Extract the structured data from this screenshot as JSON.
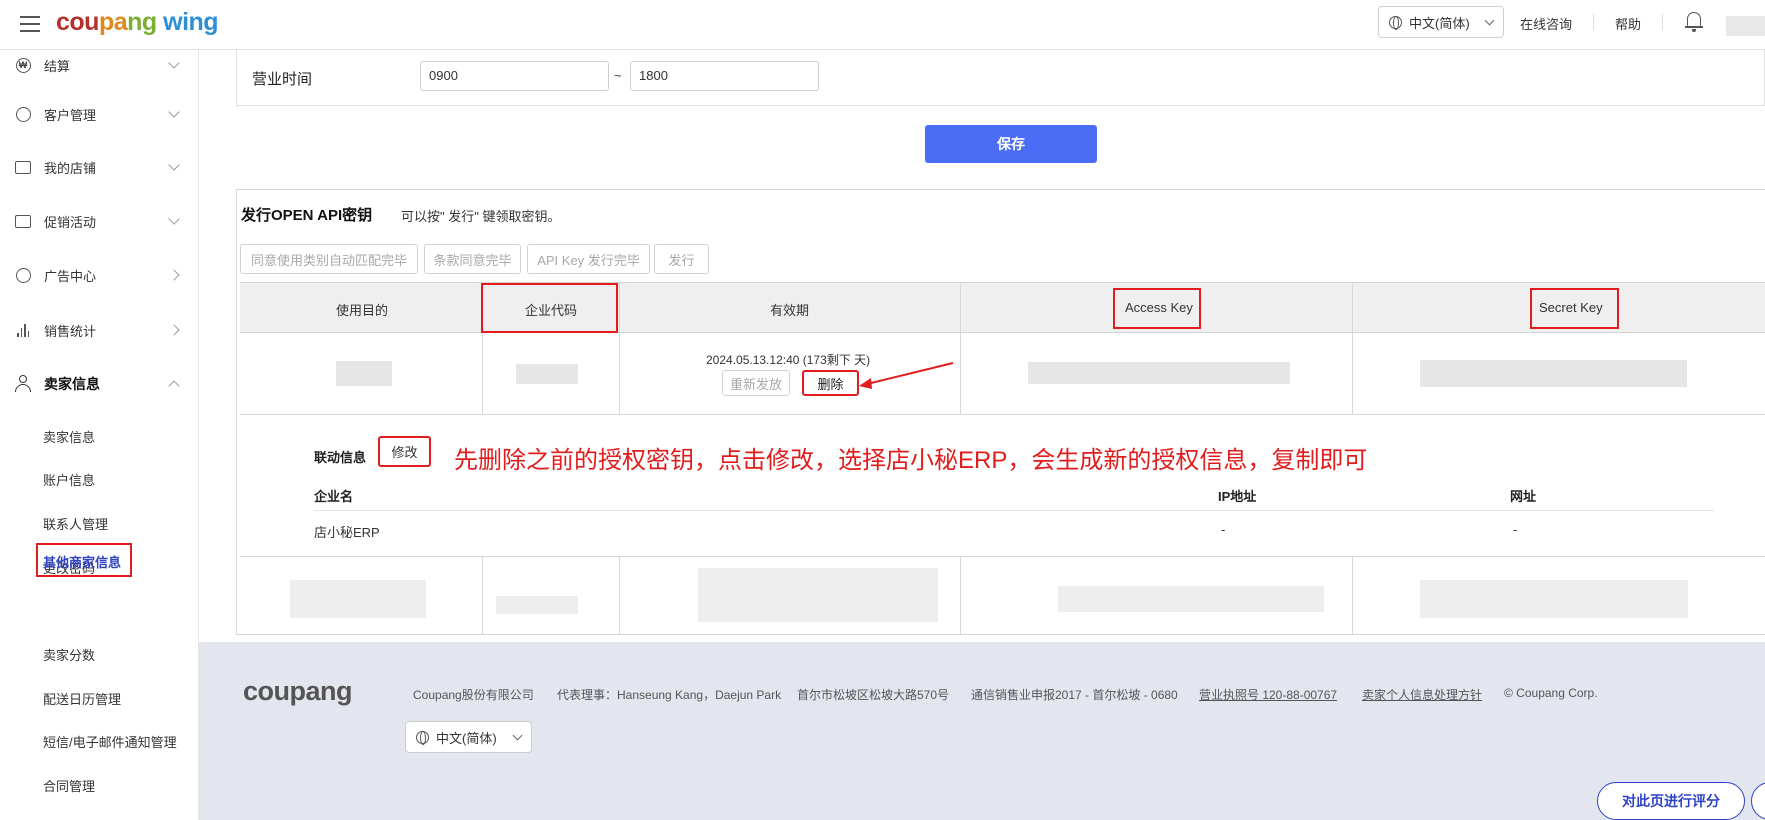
{
  "header": {
    "logo": "coupang wing",
    "language": "中文(简体)",
    "consult": "在线咨询",
    "help": "帮助"
  },
  "sidebar": {
    "items": [
      {
        "label": "结算",
        "icon": "won-icon"
      },
      {
        "label": "客户管理",
        "icon": "smile-icon"
      },
      {
        "label": "我的店铺",
        "icon": "store-icon"
      },
      {
        "label": "促销活动",
        "icon": "coupon-icon"
      },
      {
        "label": "广告中心",
        "icon": "clock-icon"
      },
      {
        "label": "销售统计",
        "icon": "bar-chart-icon"
      },
      {
        "label": "卖家信息",
        "icon": "person-icon"
      }
    ],
    "sub_items": [
      "卖家信息",
      "账户信息",
      "联系人管理",
      "更改密码",
      "其他商家信息",
      "卖家分数",
      "配送日历管理",
      "短信/电子邮件通知管理",
      "合同管理"
    ]
  },
  "business_hours": {
    "label": "营业时间",
    "start": "0900",
    "separator": "~",
    "end": "1800"
  },
  "save_label": "保存",
  "api": {
    "title": "发行OPEN API密钥",
    "description": "可以按\" 发行\" 键领取密钥。",
    "status_buttons": [
      "同意使用类别自动匹配完毕",
      "条款同意完毕",
      "API Key 发行完毕",
      "发行"
    ],
    "columns": [
      "使用目的",
      "企业代码",
      "有效期",
      "Access Key",
      "Secret Key"
    ],
    "valid_until": "2024.05.13.12:40 (173剩下 天)",
    "reissue_label": "重新发放",
    "delete_label": "删除",
    "link_info_label": "联动信息",
    "modify_label": "修改",
    "annotation": "先删除之前的授权密钥，点击修改，选择店小秘ERP，会生成新的授权信息，复制即可",
    "link_columns": [
      "企业名",
      "IP地址",
      "网址"
    ],
    "link_row": [
      "店小秘ERP",
      "-",
      "-"
    ]
  },
  "footer": {
    "logo": "coupang",
    "company": "Coupang股份有限公司",
    "ceo": "代表理事：Hanseung Kang，Daejun Park",
    "address": "首尔市松坡区松坡大路570号",
    "telecom": "通信销售业申报2017 - 首尔松坡 - 0680",
    "license": "营业执照号 120-88-00767",
    "privacy": "卖家个人信息处理方针",
    "copyright": "© Coupang Corp.",
    "language": "中文(简体)",
    "rate_label": "对此页进行评分"
  }
}
